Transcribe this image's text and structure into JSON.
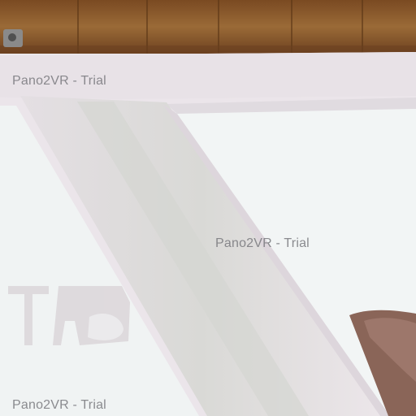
{
  "viewer": {
    "watermarks": [
      "Pano2VR - Trial",
      "Pano2VR - Trial",
      "Pano2VR - Trial"
    ]
  },
  "colors": {
    "wood": "#8b5a2b",
    "frame": "#e9e3e8",
    "panel": "#f1f4f4"
  }
}
